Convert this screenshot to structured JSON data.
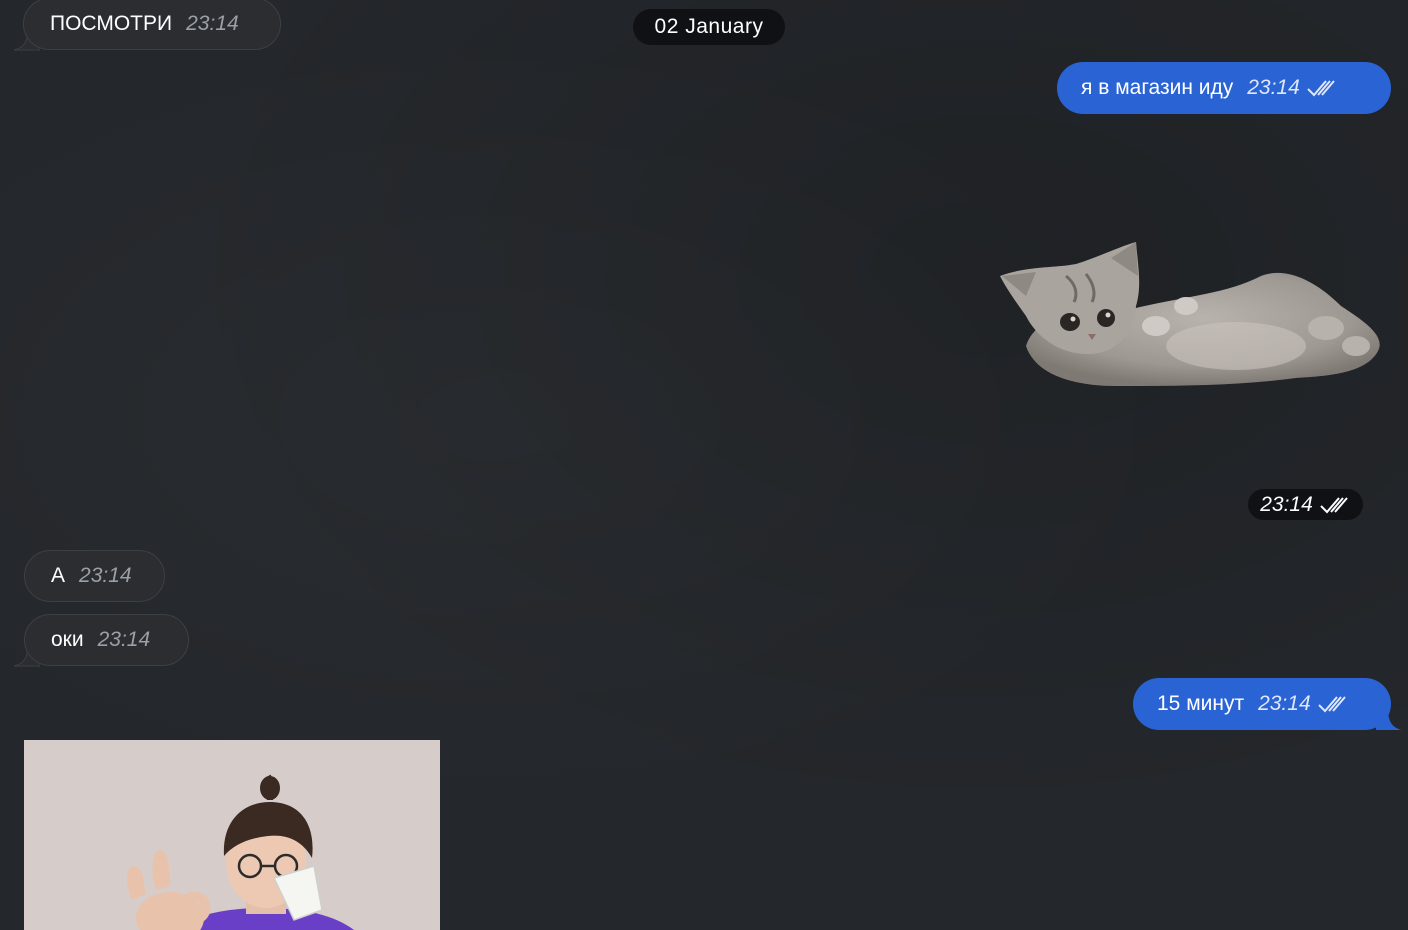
{
  "date_separator": "02 January",
  "messages": [
    {
      "direction": "incoming",
      "text": "ПОСМОТРИ",
      "time": "23:14"
    },
    {
      "direction": "outgoing",
      "text": "я в магазин иду",
      "time": "23:14",
      "status": "read"
    },
    {
      "direction": "outgoing",
      "type": "sticker",
      "sticker": "lying-kitten",
      "time": "23:14",
      "status": "read"
    },
    {
      "direction": "incoming",
      "text": "А",
      "time": "23:14"
    },
    {
      "direction": "incoming",
      "text": "оки",
      "time": "23:14"
    },
    {
      "direction": "outgoing",
      "text": "15 минут",
      "time": "23:14",
      "status": "read"
    },
    {
      "direction": "incoming",
      "type": "photo",
      "photo": "person-drinking-from-cup-ok-gesture"
    }
  ],
  "colors": {
    "background": "#24272b",
    "incoming_bubble": "#2b2d31",
    "outgoing_bubble": "#2a63d4",
    "pill": "#0f1114"
  },
  "icons": {
    "read_status": "double-check-icon"
  }
}
